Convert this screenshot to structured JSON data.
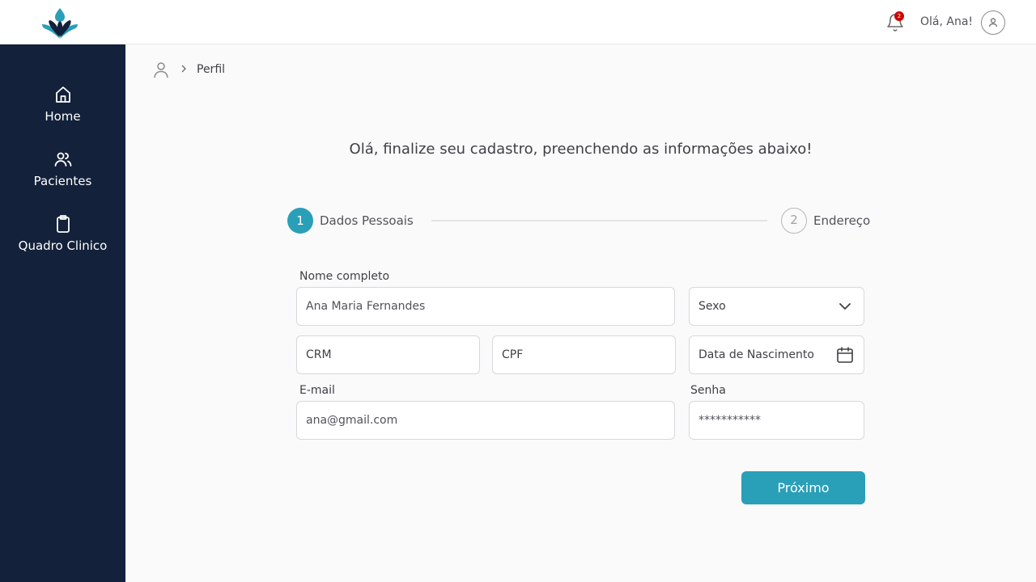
{
  "header": {
    "notification_count": "2",
    "greeting": "Olá, Ana!"
  },
  "sidebar": {
    "items": [
      {
        "label": "Home",
        "icon": "home-icon"
      },
      {
        "label": "Pacientes",
        "icon": "users-icon"
      },
      {
        "label": "Quadro Clinico",
        "icon": "clipboard-icon"
      }
    ]
  },
  "breadcrumb": {
    "current": "Perfil"
  },
  "main": {
    "headline": "Olá, finalize seu cadastro, preenchendo as informações abaixo!"
  },
  "stepper": {
    "steps": [
      {
        "number": "1",
        "label": "Dados Pessoais",
        "active": true
      },
      {
        "number": "2",
        "label": "Endereço",
        "active": false
      }
    ]
  },
  "form": {
    "full_name": {
      "label": "Nome completo",
      "value": "Ana Maria Fernandes"
    },
    "sex": {
      "placeholder": "Sexo"
    },
    "crm": {
      "placeholder": "CRM"
    },
    "cpf": {
      "placeholder": "CPF"
    },
    "birth_date": {
      "placeholder": "Data de Nascimento"
    },
    "email": {
      "label": "E-mail",
      "value": "ana@gmail.com"
    },
    "password": {
      "label": "Senha",
      "value": "***********"
    },
    "next_label": "Próximo"
  },
  "colors": {
    "sidebar_bg": "#13213a",
    "accent": "#2a9fb8",
    "badge": "#d00000"
  }
}
